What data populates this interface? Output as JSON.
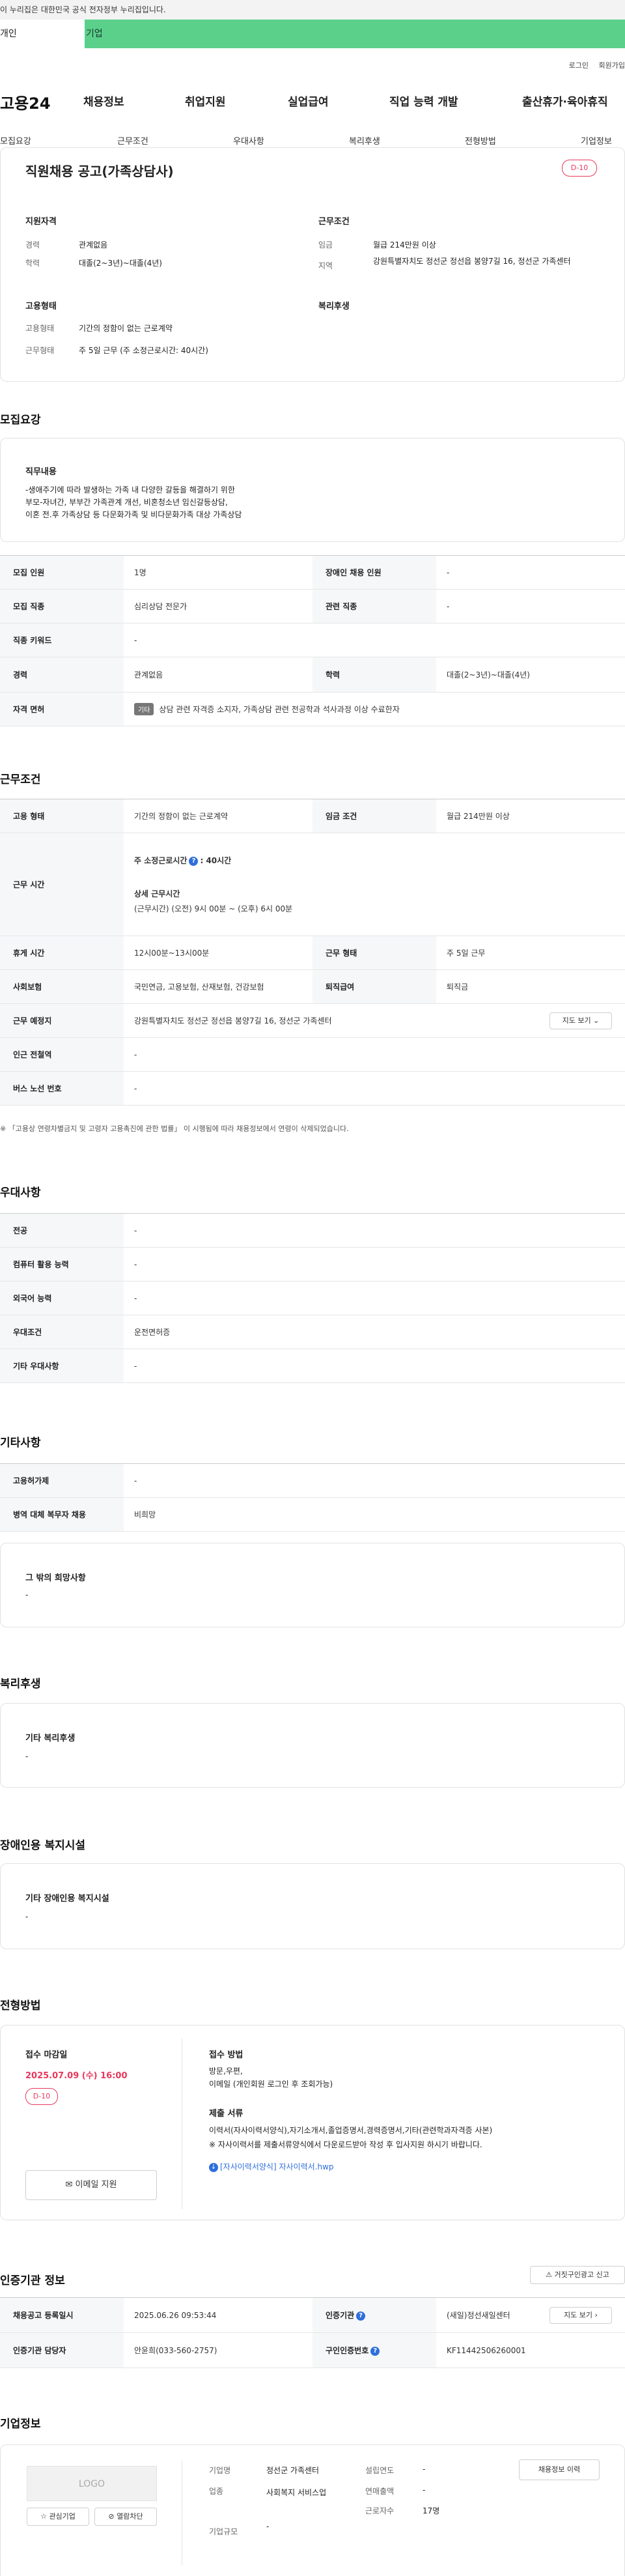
{
  "gov_banner": "이 누리집은 대한민국 공식 전자정부 누리집입니다.",
  "top_tabs": [
    {
      "label": "개인"
    },
    {
      "label": "기업"
    }
  ],
  "util_links": [
    "로그인",
    "회원가입"
  ],
  "site_logo": "고용24",
  "gnb": [
    "채용정보",
    "취업지원",
    "실업급여",
    "직업 능력 개발",
    "출산휴가·육아휴직"
  ],
  "subnav": [
    "모집요강",
    "근무조건",
    "우대사항",
    "복리후생",
    "전형방법",
    "기업정보"
  ],
  "summary": {
    "title": "직원채용 공고(가족상담사)",
    "dday": "D-10",
    "qual_title": "지원자격",
    "career_label": "경력",
    "career_value": "관계없음",
    "edu_label": "학력",
    "edu_value": "대졸(2~3년)~대졸(4년)",
    "cond_title": "근무조건",
    "wage_label": "임금",
    "wage_value": "월급 214만원 이상",
    "region_label": "지역",
    "region_value": "강원특별자치도 정선군 정선읍 봉양7길 16, 정선군 가족센터",
    "emp_title": "고용형태",
    "emptype_label": "고용형태",
    "emptype_value": "기간의 정함이 없는 근로계약",
    "worktype_label": "근무형태",
    "worktype_value": "주 5일 근무 (주 소정근로시간: 40시간)",
    "welfare_title": "복리후생"
  },
  "recruit": {
    "heading": "모집요강",
    "duty_title": "직무내용",
    "duty_lines": [
      "-생애주기에 따라 발생하는 가족 내 다양한 갈등을 해결하기 위한",
      "부모-자녀간, 부부간 가족관계 개선, 비혼청소년 임신갈등상담,",
      "이혼 전.후 가족상담 등 다문화가족 및 비다문화가족 대상 가족상담"
    ],
    "rows": [
      {
        "h1": "모집 인원",
        "v1": "1명",
        "h2": "장애인 채용 인원",
        "v2": "-"
      },
      {
        "h1": "모집 직종",
        "v1": "심리상담 전문가",
        "h2": "관련 직종",
        "v2": "-"
      },
      {
        "h1": "직종 키워드",
        "v1": "-"
      },
      {
        "h1": "경력",
        "v1": "관계없음",
        "h2": "학력",
        "v2": "대졸(2~3년)~대졸(4년)"
      },
      {
        "h1": "자격 면허",
        "chip": "기타",
        "v1": "상담 관련 자격증 소지자, 가족상담 관련 전공학과 석사과정 이상 수료한자"
      }
    ]
  },
  "conditions": {
    "heading": "근무조건",
    "emp_h": "고용 형태",
    "emp_v": "기간의 정함이 없는 근로계약",
    "wage_h": "임금 조건",
    "wage_v": "월급 214만원 이상",
    "time_h": "근무 시간",
    "time_sub": "주 소정근로시간",
    "time_hours": ": 40시간",
    "detail_title": "상세 근무시간",
    "detail_value": "(근무시간) (오전) 9시 00분 ~ (오후) 6시 00분",
    "rest_h": "휴게 시간",
    "rest_v": "12시00분~13시00분",
    "form_h": "근무 형태",
    "form_v": "주 5일 근무",
    "ins_h": "사회보험",
    "ins_v": "국민연금, 고용보험, 산재보험, 건강보험",
    "ret_h": "퇴직급여",
    "ret_v": "퇴직금",
    "addr_h": "근무 예정지",
    "addr_v": "강원특별자치도 정선군 정선읍 봉양7길 16, 정선군 가족센터",
    "map_btn": "지도 보기",
    "subway_h": "인근 전철역",
    "subway_v": "-",
    "bus_h": "버스 노선 번호",
    "bus_v": "-",
    "note": "※ 「고용상 연령차별금지 및 고령자 고용촉진에 관한 법률」 이 시행됨에 따라 채용정보에서 연령이 삭제되었습니다."
  },
  "preference": {
    "heading": "우대사항",
    "rows": [
      {
        "h": "전공",
        "v": "-"
      },
      {
        "h": "컴퓨터 활용 능력",
        "v": "-"
      },
      {
        "h": "외국어 능력",
        "v": "-"
      },
      {
        "h": "우대조건",
        "v": "운전면허증"
      },
      {
        "h": "기타 우대사항",
        "v": "-"
      }
    ]
  },
  "etc": {
    "heading": "기타사항",
    "rows": [
      {
        "h": "고용허가제",
        "v": "-"
      },
      {
        "h": "병역 대체 복무자 채용",
        "v": "비희망"
      }
    ],
    "box_title": "그 밖의 희망사항",
    "box_value": "-"
  },
  "welfare": {
    "heading": "복리후생",
    "box_title": "기타 복리후생",
    "box_value": "-"
  },
  "disability": {
    "heading": "장애인용 복지시설",
    "box_title": "기타 장애인용 복지시설",
    "box_value": "-"
  },
  "screening": {
    "heading": "전형방법",
    "deadline_label": "접수 마감일",
    "deadline": "2025.07.09 (수) 16:00",
    "dday": "D-10",
    "email_btn": "이메일 지원",
    "method_title": "접수 방법",
    "method_lines": [
      "방문,우편,",
      "이메일 (개인회원 로그인 후 조회가능)"
    ],
    "docs_title": "제출 서류",
    "docs_lines": [
      "이력서(자사이력서양식),자기소개서,졸업증명서,경력증명서,기타(관련학과자격증 사본)",
      "※ 자사이력서를 제출서류양식에서 다운로드받아 작성 후 입사지원 하시기 바랍니다."
    ],
    "file": "[자사이력서양식] 자사이력서.hwp"
  },
  "certify": {
    "heading": "인증기관 정보",
    "report_btn": "거짓구인광고 신고",
    "reg_h": "채용공고 등록일시",
    "reg_v": "2025.06.26 09:53:44",
    "org_h": "인증기관",
    "org_v": "(새일)정선새일센터",
    "map_btn": "지도 보기",
    "staff_h": "인증기관 담당자",
    "staff_v": "안윤희(033-560-2757)",
    "no_h": "구인인증번호",
    "no_v": "KF11442506260001"
  },
  "company": {
    "heading": "기업정보",
    "logo_text": "LOGO",
    "fav_btn": "관심기업",
    "block_btn": "열람차단",
    "name_label": "기업명",
    "name_value": "정선군 가족센터",
    "industry_label": "업종",
    "industry_value": "사회복지 서비스업",
    "size_label": "기업규모",
    "size_value": "-",
    "year_label": "설립연도",
    "year_value": "-",
    "sales_label": "연매출액",
    "sales_value": "-",
    "staff_label": "근로자수",
    "staff_value": "17명",
    "history_btn": "채용정보 이력"
  }
}
